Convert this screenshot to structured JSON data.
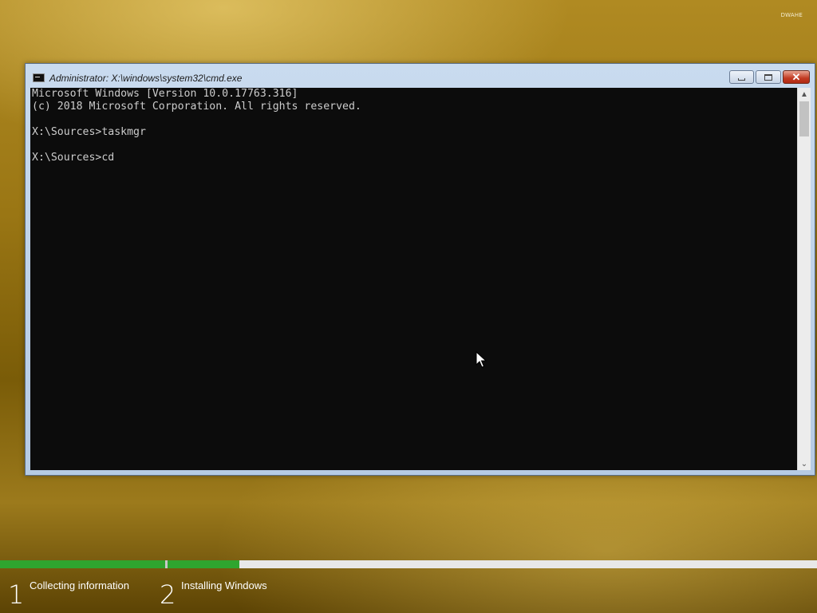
{
  "corner_tag": "DWAHE",
  "window": {
    "title": "Administrator: X:\\windows\\system32\\cmd.exe",
    "close_glyph": "✕",
    "console_lines": [
      "Microsoft Windows [Version 10.0.17763.316]",
      "(c) 2018 Microsoft Corporation. All rights reserved.",
      "",
      "X:\\Sources>taskmgr",
      "",
      "X:\\Sources>cd"
    ],
    "scroll_up_glyph": "▲",
    "scroll_down_glyph": "⌄"
  },
  "setup": {
    "steps": [
      {
        "number": "1",
        "label": "Collecting information",
        "progress": 1.0
      },
      {
        "number": "2",
        "label": "Installing Windows",
        "progress": 0.11
      }
    ]
  },
  "colors": {
    "progress_fill": "#2fa52f",
    "console_bg": "#0c0c0c",
    "console_fg": "#cccccc"
  }
}
